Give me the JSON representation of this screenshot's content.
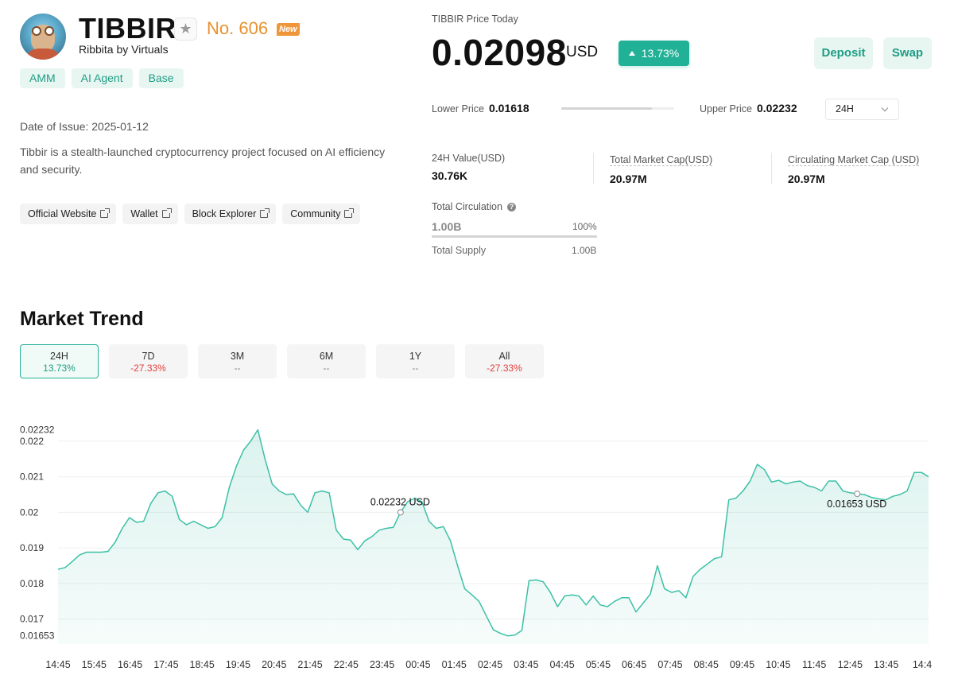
{
  "token": {
    "symbol": "TIBBIR",
    "rank": "No. 606",
    "new_badge": "New",
    "name": "Ribbita by Virtuals",
    "tags": [
      "AMM",
      "AI Agent",
      "Base"
    ],
    "issue_date": "Date of Issue: 2025-01-12",
    "description": "Tibbir is a stealth-launched cryptocurrency project focused on AI efficiency and security.",
    "links": [
      "Official Website",
      "Wallet",
      "Block Explorer",
      "Community"
    ]
  },
  "price": {
    "label": "TIBBIR Price Today",
    "value": "0.02098",
    "unit": "USD",
    "change": "13.73%",
    "deposit_label": "Deposit",
    "swap_label": "Swap",
    "lower_label": "Lower Price",
    "lower_value": "0.01618",
    "upper_label": "Upper Price",
    "upper_value": "0.02232",
    "range_position": 0.8,
    "period": "24H"
  },
  "stats": {
    "value_24h_label": "24H Value(USD)",
    "value_24h": "30.76K",
    "market_cap_label": "Total Market Cap(USD)",
    "market_cap": "20.97M",
    "circ_cap_label": "Circulating Market Cap (USD)",
    "circ_cap": "20.97M",
    "circulation_label": "Total Circulation",
    "circulation": "1.00B",
    "circulation_pct": "100%",
    "circulation_fraction": 1.0,
    "supply_label": "Total Supply",
    "supply": "1.00B"
  },
  "trend": {
    "title": "Market Trend",
    "tabs": [
      {
        "name": "24H",
        "change": "13.73%",
        "dir": "up",
        "active": true
      },
      {
        "name": "7D",
        "change": "-27.33%",
        "dir": "down",
        "active": false
      },
      {
        "name": "3M",
        "change": "--",
        "dir": "none",
        "active": false
      },
      {
        "name": "6M",
        "change": "--",
        "dir": "none",
        "active": false
      },
      {
        "name": "1Y",
        "change": "--",
        "dir": "none",
        "active": false
      },
      {
        "name": "All",
        "change": "-27.33%",
        "dir": "down",
        "active": false
      }
    ]
  },
  "colors": {
    "accent": "#21b196",
    "accent_text": "#1f9d85",
    "negative": "#e0413d",
    "rank": "#e8922e"
  },
  "icons": [
    "star-icon",
    "external-link-icon",
    "triangle-up-icon",
    "chevron-down-icon",
    "help-icon"
  ],
  "chart_data": {
    "type": "area",
    "xlabel": "",
    "ylabel": "",
    "grid": true,
    "ylim": [
      0.0163,
      0.0226
    ],
    "y_ticks": [
      "0.01653",
      "0.017",
      "0.018",
      "0.019",
      "0.02",
      "0.021",
      "0.022",
      "0.02232"
    ],
    "y_tick_values": [
      0.01653,
      0.017,
      0.018,
      0.019,
      0.02,
      0.021,
      0.022,
      0.02232
    ],
    "x_ticks": [
      "14:45",
      "15:45",
      "16:45",
      "17:45",
      "18:45",
      "19:45",
      "20:45",
      "21:45",
      "22:45",
      "23:45",
      "00:45",
      "01:45",
      "02:45",
      "03:45",
      "04:45",
      "05:45",
      "06:45",
      "07:45",
      "08:45",
      "09:45",
      "10:45",
      "11:45",
      "12:45",
      "13:45",
      "14:4"
    ],
    "max_annotation": "0.02232  USD",
    "min_annotation": "0.01653  USD",
    "max_index": 48,
    "min_index": 112,
    "series": [
      {
        "values": [
          0.0184,
          0.01845,
          0.01862,
          0.0188,
          0.01888,
          0.01888,
          0.01888,
          0.0189,
          0.01916,
          0.01955,
          0.01985,
          0.01972,
          0.01975,
          0.02025,
          0.02055,
          0.0206,
          0.02045,
          0.0198,
          0.01965,
          0.01975,
          0.01965,
          0.01955,
          0.0196,
          0.01985,
          0.0207,
          0.0213,
          0.02175,
          0.022,
          0.02232,
          0.0215,
          0.0208,
          0.0206,
          0.0205,
          0.02052,
          0.0202,
          0.02,
          0.02055,
          0.0206,
          0.02055,
          0.0195,
          0.01925,
          0.01922,
          0.01895,
          0.0192,
          0.01932,
          0.0195,
          0.01955,
          0.01958,
          0.02,
          0.0203,
          0.0204,
          0.0203,
          0.01975,
          0.01955,
          0.0196,
          0.0192,
          0.0185,
          0.01785,
          0.01768,
          0.0175,
          0.0171,
          0.0167,
          0.0166,
          0.01653,
          0.01655,
          0.01668,
          0.01808,
          0.0181,
          0.01805,
          0.01775,
          0.01735,
          0.01765,
          0.01768,
          0.01765,
          0.0174,
          0.01765,
          0.0174,
          0.01735,
          0.0175,
          0.0176,
          0.0176,
          0.0172,
          0.01745,
          0.0177,
          0.0185,
          0.01785,
          0.01775,
          0.0178,
          0.0176,
          0.0182,
          0.0184,
          0.01855,
          0.0187,
          0.01875,
          0.02035,
          0.0204,
          0.0206,
          0.02088,
          0.02135,
          0.0212,
          0.02085,
          0.0209,
          0.0208,
          0.02085,
          0.02088,
          0.02075,
          0.0207,
          0.0206,
          0.02088,
          0.02088,
          0.0206,
          0.02055,
          0.02052,
          0.0205,
          0.02042,
          0.02038,
          0.02035,
          0.02045,
          0.0205,
          0.0206,
          0.02112,
          0.02112,
          0.021
        ],
        "x_fraction_of_index": "uniform"
      }
    ]
  }
}
